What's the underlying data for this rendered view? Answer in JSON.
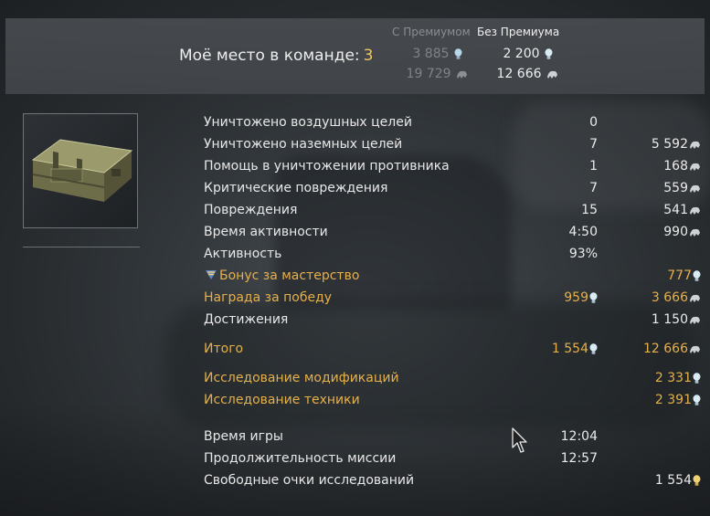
{
  "header": {
    "col_premium": "С Премиумом",
    "col_no_premium": "Без Премиума",
    "place_label": "Моё место в команде:",
    "place_value": "3",
    "prem_lions_1": "3 885",
    "noprem_lions_1": "2 200",
    "prem_rp": "19 729",
    "noprem_rp": "12 666"
  },
  "rows": [
    {
      "label": "Уничтожено воздушных целей",
      "v1": "0",
      "v2": ""
    },
    {
      "label": "Уничтожено наземных целей",
      "v1": "7",
      "v2": "5 592"
    },
    {
      "label": "Помощь в уничтожении противника",
      "v1": "1",
      "v2": "168"
    },
    {
      "label": "Критические повреждения",
      "v1": "7",
      "v2": "559"
    },
    {
      "label": "Повреждения",
      "v1": "15",
      "v2": "541"
    },
    {
      "label": "Время активности",
      "v1": "4:50",
      "v2": "990"
    },
    {
      "label": "Активность",
      "v1": "93%",
      "v2": ""
    },
    {
      "label": "Бонус за мастерство",
      "v1": "",
      "v2": "777"
    },
    {
      "label": "Награда за победу",
      "v1": "959",
      "v2": "3 666"
    },
    {
      "label": "Достижения",
      "v1": "",
      "v2": "1 150"
    },
    {
      "label": "Итого",
      "v1": "1 554",
      "v2": "12 666"
    },
    {
      "label": "Исследование модификаций",
      "v1": "",
      "v2": "2 331"
    },
    {
      "label": "Исследование техники",
      "v1": "",
      "v2": "2 391"
    },
    {
      "label": "Время игры",
      "v1": "12:04",
      "v2": ""
    },
    {
      "label": "Продолжительность миссии",
      "v1": "12:57",
      "v2": ""
    },
    {
      "label": "Свободные очки исследований",
      "v1": "",
      "v2": "1 554"
    }
  ],
  "colors": {
    "gold": "#e6b04a",
    "place_number": "#f2c55a",
    "text": "#e8e8e8",
    "dim": "#7f8387"
  },
  "icons": {
    "lions": "silver-lions-icon",
    "research": "research-points-icon",
    "free_research": "free-research-points-icon",
    "mastery": "mastery-badge-icon",
    "item": "ammo-crate-icon",
    "cursor": "mouse-cursor-icon"
  }
}
